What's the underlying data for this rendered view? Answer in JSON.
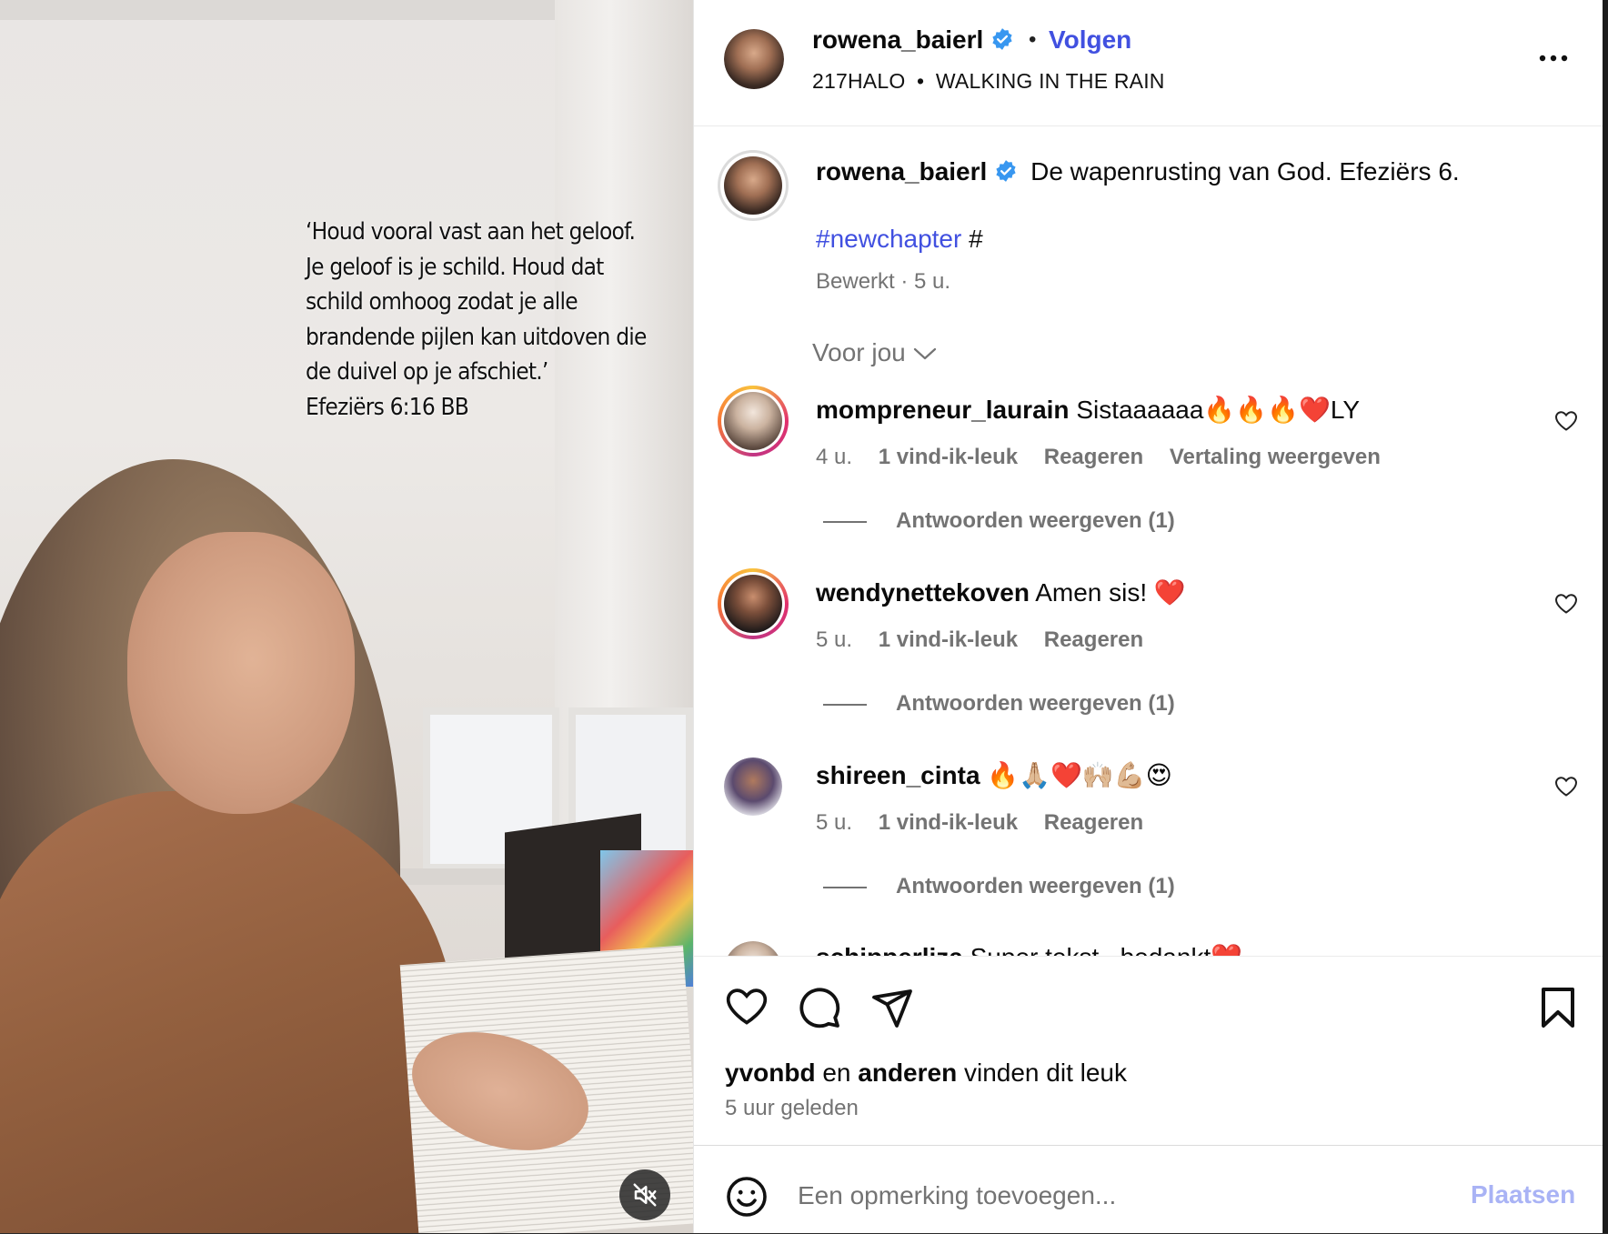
{
  "media": {
    "quote": "‘Houd vooral vast aan het geloof.\nJe geloof is je schild. Houd dat\nschild omhoog zodat je alle\nbrandende pijlen kan uitdoven die\nde duivel op je afschiet.’\nEfeziërs 6:16 BB",
    "mute_icon": "speaker-muted-icon"
  },
  "header": {
    "username": "rowena_baierl",
    "verified": true,
    "separator": "•",
    "follow_label": "Volgen",
    "audio_artist": "217HALO",
    "audio_separator": "•",
    "audio_title": "WALKING IN THE RAIN",
    "more_icon": "more-options-icon"
  },
  "caption": {
    "username": "rowena_baierl",
    "text": "De wapenrusting van God. Efeziërs 6.",
    "hashtag": "#newchapter",
    "hashtag_rest": " #",
    "meta": "Bewerkt · 5 u."
  },
  "sort": {
    "label": "Voor jou"
  },
  "comments": [
    {
      "username": "mompreneur_laurain",
      "text": "Sistaaaaaa🔥🔥🔥❤️LY",
      "time": "4 u.",
      "likes": "1 vind-ik-leuk",
      "reply": "Reageren",
      "translate": "Vertaling weergeven",
      "view_replies": "Antwoorden weergeven (1)"
    },
    {
      "username": "wendynettekoven",
      "text": "Amen sis! ❤️",
      "time": "5 u.",
      "likes": "1 vind-ik-leuk",
      "reply": "Reageren",
      "view_replies": "Antwoorden weergeven (1)"
    },
    {
      "username": "shireen_cinta",
      "text": "🔥🙏🏼❤️🙌🏼💪🏼😍",
      "time": "5 u.",
      "likes": "1 vind-ik-leuk",
      "reply": "Reageren",
      "view_replies": "Antwoorden weergeven (1)"
    },
    {
      "username": "schipperliza",
      "text": "Super tekst , bedankt❤️"
    }
  ],
  "likes": {
    "user": "yvonbd",
    "connector": " en ",
    "others": "anderen",
    "suffix": " vinden dit leuk",
    "time": "5 uur geleden"
  },
  "comment_bar": {
    "placeholder": "Een opmerking toevoegen...",
    "post_label": "Plaatsen"
  },
  "colors": {
    "accent": "#4150e0",
    "verified": "#3897f0",
    "muted_text": "#737373",
    "post_disabled": "#a9b3f5"
  }
}
